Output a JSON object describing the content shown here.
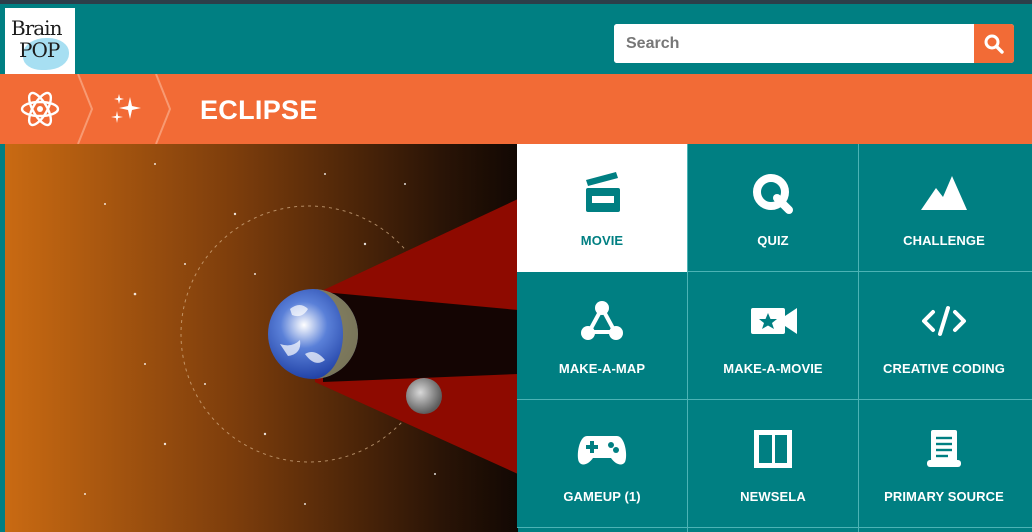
{
  "app": {
    "logo_line1": "Brain",
    "logo_line2": "POP"
  },
  "search": {
    "placeholder": "Search"
  },
  "breadcrumb": {
    "items": [
      {
        "icon": "atom-icon"
      },
      {
        "icon": "sparkles-icon"
      }
    ],
    "title": "ECLIPSE"
  },
  "features": [
    {
      "label": "MOVIE",
      "icon": "clapperboard-icon",
      "active": true
    },
    {
      "label": "QUIZ",
      "icon": "quiz-q-icon",
      "active": false
    },
    {
      "label": "CHALLENGE",
      "icon": "mountain-icon",
      "active": false
    },
    {
      "label": "MAKE-A-MAP",
      "icon": "concept-map-icon",
      "active": false
    },
    {
      "label": "MAKE-A-MOVIE",
      "icon": "video-camera-star-icon",
      "active": false
    },
    {
      "label": "CREATIVE CODING",
      "icon": "code-icon",
      "active": false
    },
    {
      "label": "GAMEUP (1)",
      "icon": "gamepad-icon",
      "active": false
    },
    {
      "label": "NEWSELA",
      "icon": "book-icon",
      "active": false
    },
    {
      "label": "PRIMARY SOURCE",
      "icon": "scroll-icon",
      "active": false
    }
  ],
  "colors": {
    "teal": "#007f82",
    "orange": "#f26b36",
    "active_tile": "#ffffff"
  }
}
